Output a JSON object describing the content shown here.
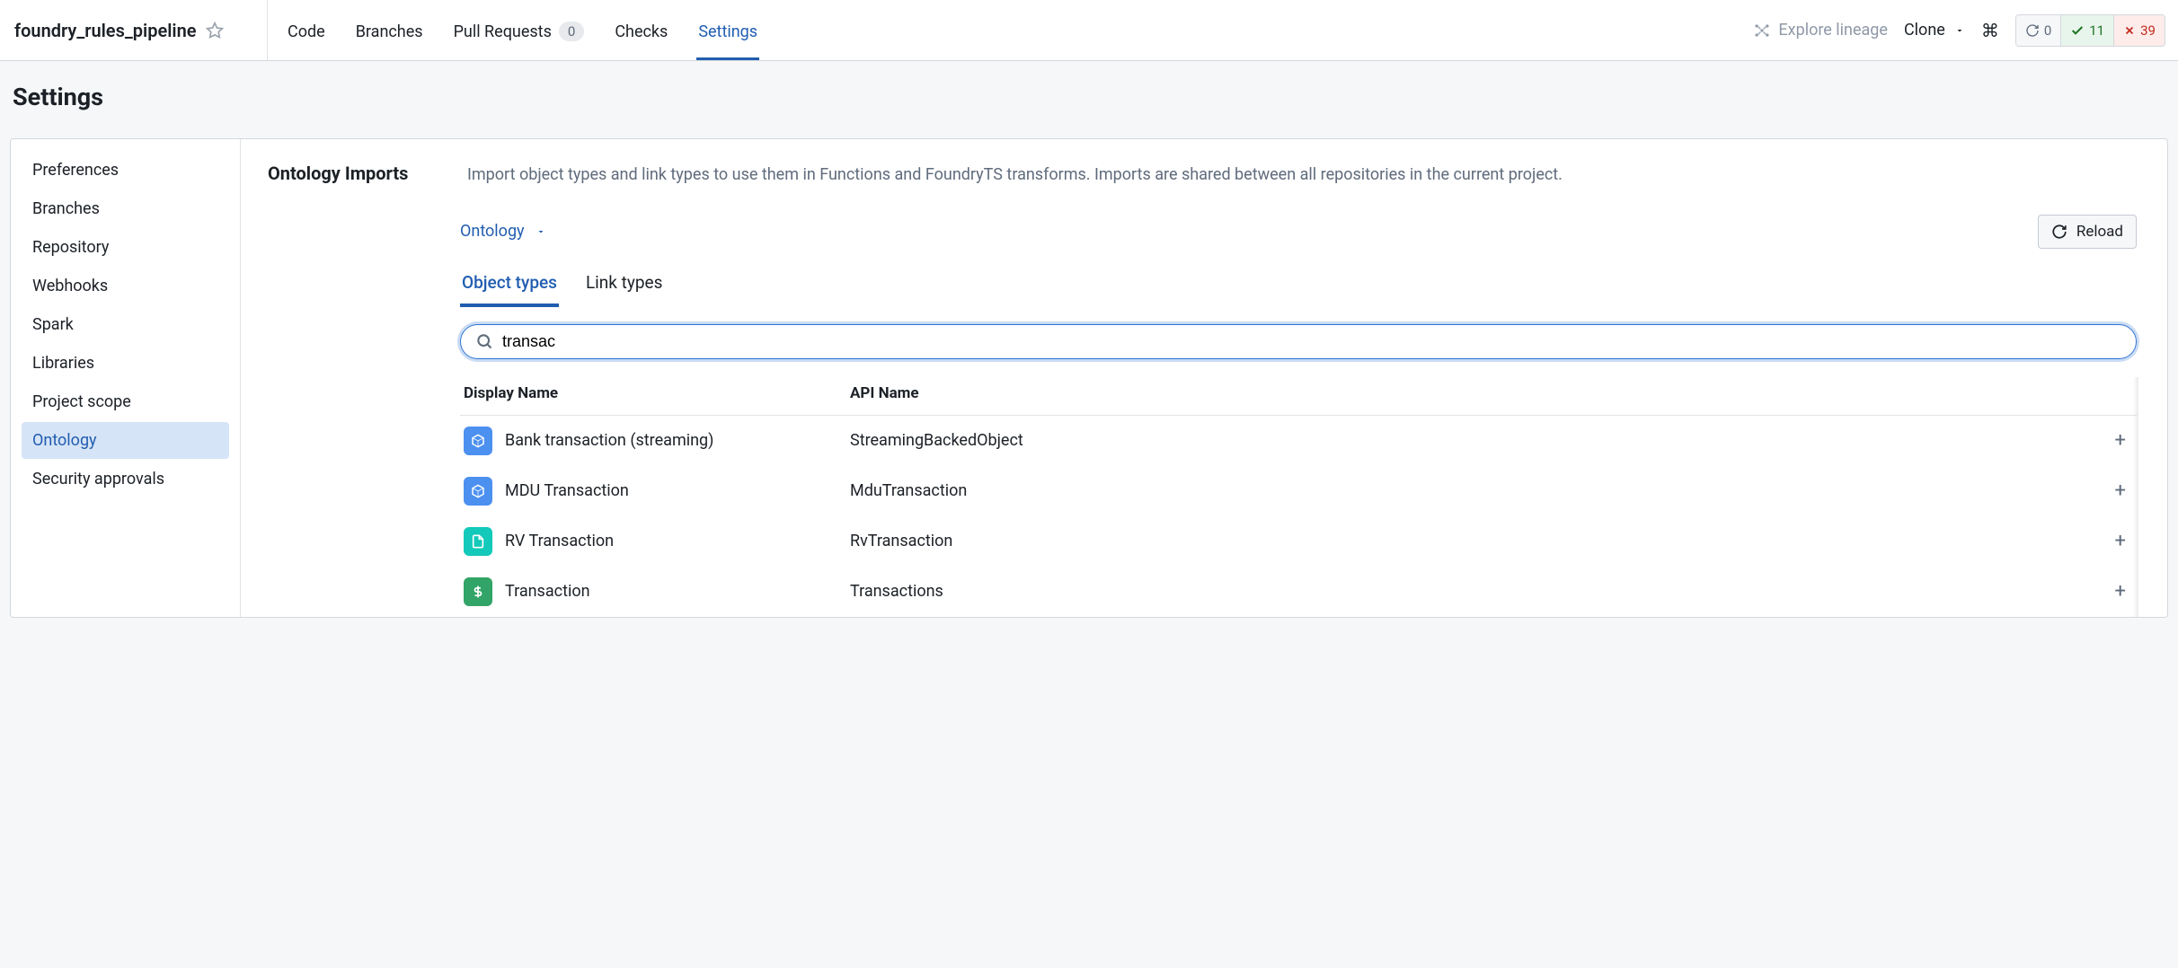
{
  "header": {
    "repo_name": "foundry_rules_pipeline",
    "tabs": {
      "code": "Code",
      "branches": "Branches",
      "pull_requests": "Pull Requests",
      "pr_count": "0",
      "checks": "Checks",
      "settings": "Settings"
    },
    "explore_lineage": "Explore lineage",
    "clone": "Clone",
    "status": {
      "sync": "0",
      "pass": "11",
      "fail": "39"
    }
  },
  "page_title": "Settings",
  "sidebar": {
    "items": [
      {
        "label": "Preferences"
      },
      {
        "label": "Branches"
      },
      {
        "label": "Repository"
      },
      {
        "label": "Webhooks"
      },
      {
        "label": "Spark"
      },
      {
        "label": "Libraries"
      },
      {
        "label": "Project scope"
      },
      {
        "label": "Ontology"
      },
      {
        "label": "Security approvals"
      }
    ],
    "active_index": 7
  },
  "main": {
    "section_title": "Ontology Imports",
    "section_desc": "Import object types and link types to use them in Functions and FoundryTS transforms. Imports are shared between all repositories in the current project.",
    "ontology_selector": "Ontology",
    "reload": "Reload",
    "subtabs": {
      "object_types": "Object types",
      "link_types": "Link types"
    },
    "search_value": "transac",
    "columns": {
      "display": "Display Name",
      "api": "API Name"
    },
    "rows": [
      {
        "display": "Bank transaction (streaming)",
        "api": "StreamingBackedObject",
        "icon": "cube-blue"
      },
      {
        "display": "MDU Transaction",
        "api": "MduTransaction",
        "icon": "cube-blue"
      },
      {
        "display": "RV Transaction",
        "api": "RvTransaction",
        "icon": "doc-teal"
      },
      {
        "display": "Transaction",
        "api": "Transactions",
        "icon": "dollar-green"
      }
    ]
  }
}
